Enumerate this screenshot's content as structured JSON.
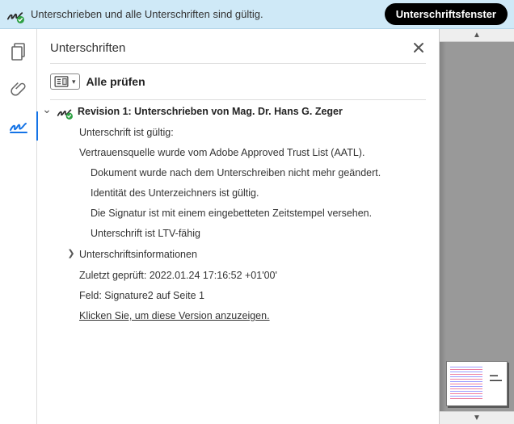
{
  "topbar": {
    "status_text": "Unterschrieben und alle Unterschriften sind gültig.",
    "panel_button": "Unterschriftsfenster"
  },
  "panel": {
    "title": "Unterschriften",
    "check_all": "Alle prüfen"
  },
  "revision": {
    "title": "Revision 1: Unterschrieben von Mag. Dr. Hans G. Zeger",
    "valid_line": "Unterschrift ist gültig:",
    "trust_line": "Vertrauensquelle wurde vom Adobe Approved Trust List (AATL).",
    "sub": {
      "unchanged": "Dokument wurde nach dem Unterschreiben nicht mehr geändert.",
      "identity": "Identität des Unterzeichners ist gültig.",
      "timestamp": "Die Signatur ist mit einem eingebetteten Zeitstempel versehen.",
      "ltv": "Unterschrift ist LTV-fähig"
    },
    "info_label": "Unterschriftsinformationen",
    "last_checked": "Zuletzt geprüft: 2022.01.24 17:16:52 +01'00'",
    "field": "Feld: Signature2 auf Seite 1",
    "view_link": "Klicken Sie, um diese Version anzuzeigen."
  }
}
